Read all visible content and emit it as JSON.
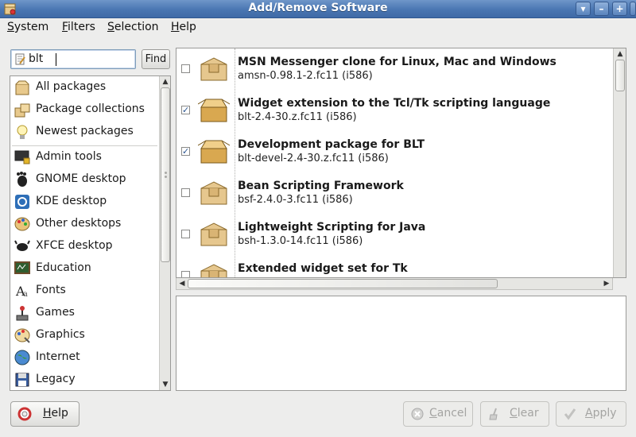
{
  "window": {
    "title": "Add/Remove Software"
  },
  "menu": [
    "System",
    "Filters",
    "Selection",
    "Help"
  ],
  "search": {
    "value": "blt",
    "find_label": "Find"
  },
  "categories": [
    {
      "label": "All packages",
      "icon": "package-icon"
    },
    {
      "label": "Package collections",
      "icon": "package-collection-icon"
    },
    {
      "label": "Newest packages",
      "icon": "lightbulb-icon"
    },
    {
      "label": "Admin tools",
      "icon": "monitor-lock-icon"
    },
    {
      "label": "GNOME desktop",
      "icon": "gnome-foot-icon"
    },
    {
      "label": "KDE desktop",
      "icon": "kde-gear-icon"
    },
    {
      "label": "Other desktops",
      "icon": "palette-icon"
    },
    {
      "label": "XFCE desktop",
      "icon": "xfce-mouse-icon"
    },
    {
      "label": "Education",
      "icon": "chalkboard-icon"
    },
    {
      "label": "Fonts",
      "icon": "font-icon"
    },
    {
      "label": "Games",
      "icon": "joystick-icon"
    },
    {
      "label": "Graphics",
      "icon": "paint-palette-icon"
    },
    {
      "label": "Internet",
      "icon": "globe-icon"
    },
    {
      "label": "Legacy",
      "icon": "floppy-icon"
    }
  ],
  "packages": [
    {
      "name": "MSN Messenger clone for Linux, Mac and Windows",
      "version": "amsn-0.98.1-2.fc11 (i586)",
      "installed": false
    },
    {
      "name": "Widget extension to the Tcl/Tk scripting language",
      "version": "blt-2.4-30.z.fc11 (i586)",
      "installed": true
    },
    {
      "name": "Development package for BLT",
      "version": "blt-devel-2.4-30.z.fc11 (i586)",
      "installed": true
    },
    {
      "name": "Bean Scripting Framework",
      "version": "bsf-2.4.0-3.fc11 (i586)",
      "installed": false
    },
    {
      "name": "Lightweight Scripting for Java",
      "version": "bsh-1.3.0-14.fc11 (i586)",
      "installed": false
    },
    {
      "name": "Extended widget set for Tk",
      "version": "",
      "installed": false
    }
  ],
  "buttons": {
    "help": "Help",
    "cancel": "Cancel",
    "clear": "Clear",
    "apply": "Apply"
  },
  "colors": {
    "titlebar": "#4a76b2",
    "selection_check": "#2a5590"
  }
}
